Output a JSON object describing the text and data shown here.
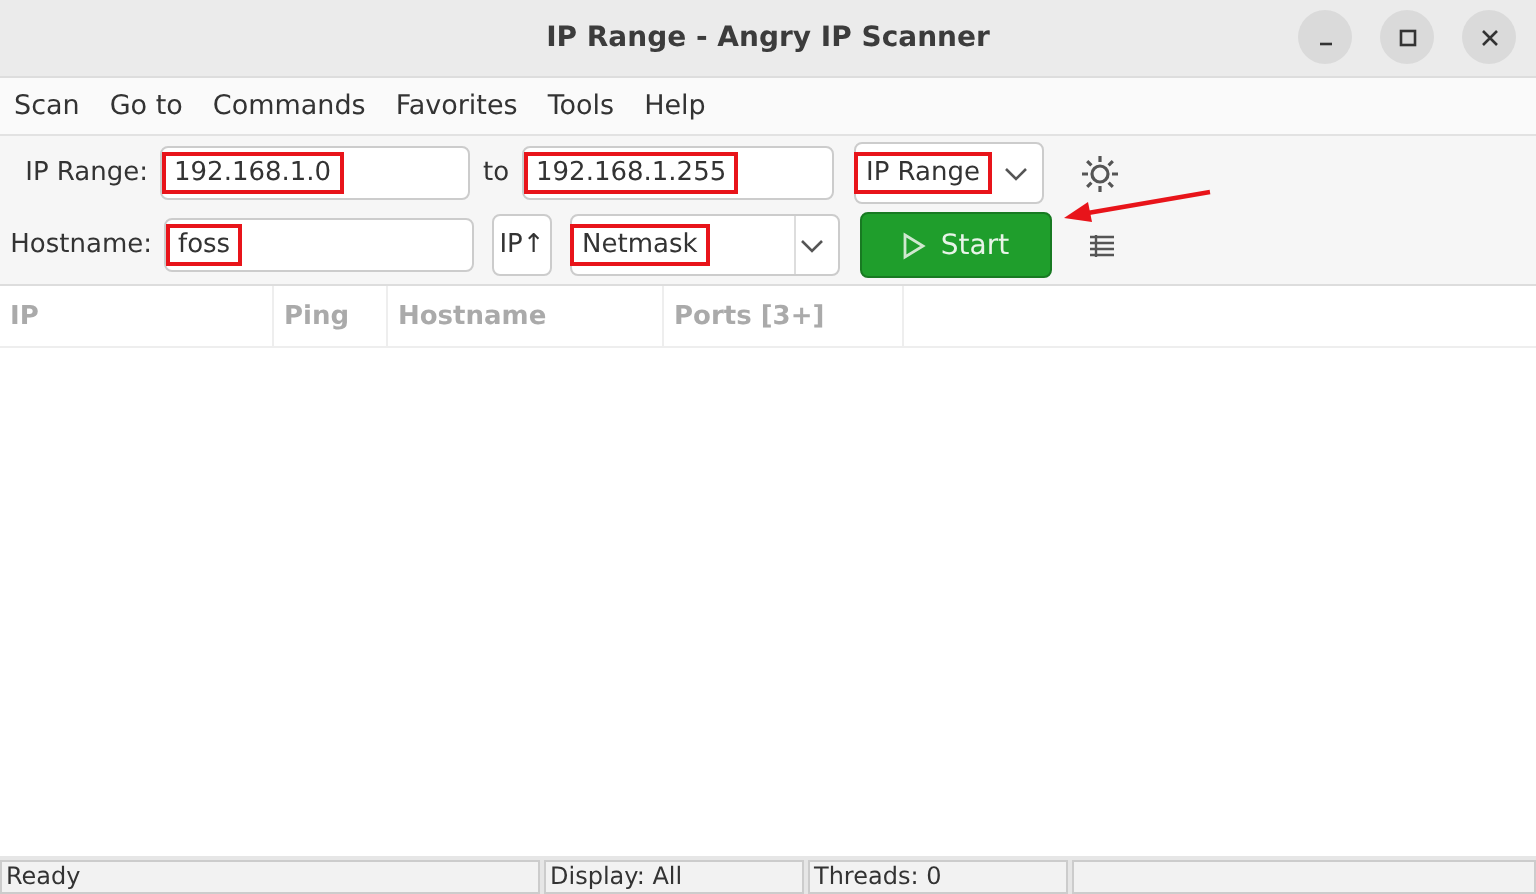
{
  "window": {
    "title": "IP Range - Angry IP Scanner"
  },
  "menu": [
    "Scan",
    "Go to",
    "Commands",
    "Favorites",
    "Tools",
    "Help"
  ],
  "range_row": {
    "label": "IP Range:",
    "start": {
      "value": "192.168.1.0",
      "highlighted": true
    },
    "to_label": "to",
    "end": {
      "value": "192.168.1.255",
      "highlighted": true
    },
    "feeder": {
      "value": "IP Range",
      "highlighted": true
    }
  },
  "host_row": {
    "label": "Hostname:",
    "hostname": {
      "value": "foss",
      "highlighted": true
    },
    "ip_button": "IP↑",
    "netmask": {
      "value": "Netmask",
      "highlighted": true
    },
    "start_button": "Start",
    "start_arrow_annotation": true
  },
  "table": {
    "columns": [
      "IP",
      "Ping",
      "Hostname",
      "Ports [3+]"
    ]
  },
  "status_bar": [
    "Ready",
    "Display: All",
    "Threads: 0"
  ]
}
